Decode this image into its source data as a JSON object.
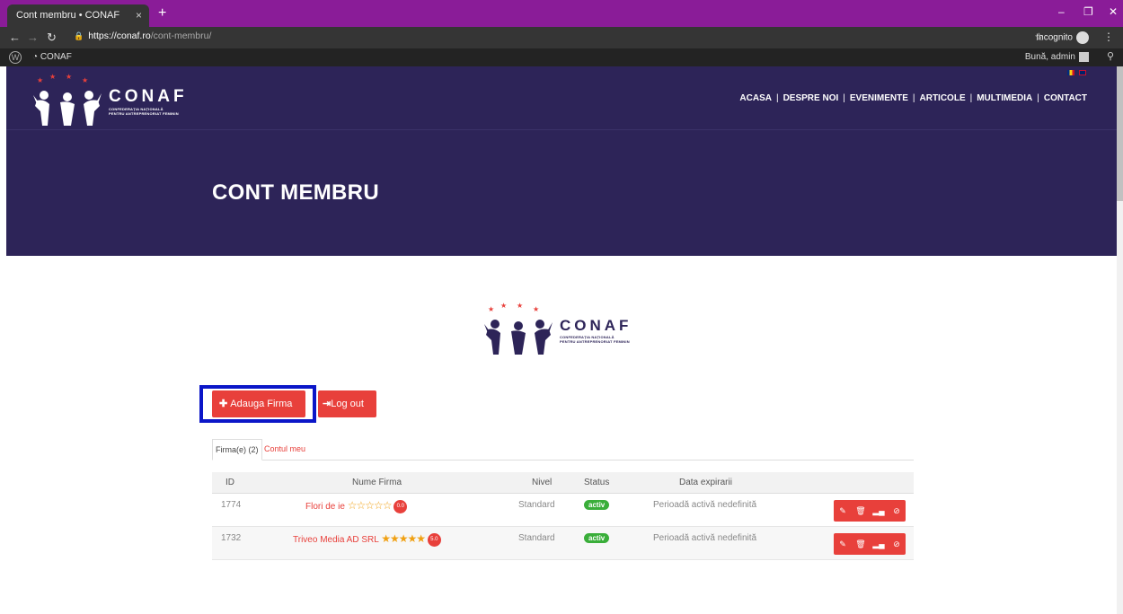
{
  "browser": {
    "tab_title": "Cont membru • CONAF",
    "tab_close": "×",
    "new_tab": "+",
    "url_host": "https://conaf.ro",
    "url_path": "/cont-membru/",
    "incognito_label": "Incognito"
  },
  "wp_admin_bar": {
    "site_name": "CONAF",
    "greeting": "Bună, admin"
  },
  "header": {
    "logo_name": "CONAF",
    "logo_sub_1": "CONFEDERAȚIA NAȚIONALĂ",
    "logo_sub_2": "PENTRU ANTREPRENORIAT FEMININ",
    "nav": [
      "ACASA",
      "DESPRE NOI",
      "EVENIMENTE",
      "ARTICOLE",
      "MULTIMEDIA",
      "CONTACT"
    ],
    "nav_separator": "|"
  },
  "hero": {
    "title": "CONT MEMBRU"
  },
  "actions": {
    "add_company": "Adauga Firma",
    "logout": "Log out"
  },
  "tabs": {
    "companies": "Firma(e) (2)",
    "account": "Contul meu"
  },
  "table": {
    "columns": [
      "ID",
      "Nume Firma",
      "Nivel",
      "Status",
      "Data expirarii"
    ],
    "rows": [
      {
        "id": "1774",
        "name": "Flori de ie",
        "stars": "☆☆☆☆☆",
        "score": "0.0",
        "level": "Standard",
        "status": "activ",
        "expiry": "Perioadă activă nedefinită"
      },
      {
        "id": "1732",
        "name": "Triveo Media AD SRL",
        "stars": "★★★★★",
        "score": "5.0",
        "level": "Standard",
        "status": "activ",
        "expiry": "Perioadă activă nedefinită"
      }
    ]
  },
  "colors": {
    "brand_purple": "#2d2458",
    "accent_red": "#e8403b",
    "status_green": "#3aae3a",
    "highlight_blue": "#0b16c8",
    "tabstrip": "#8a1c98"
  },
  "icons": {
    "back": "back-arrow-icon",
    "forward": "forward-arrow-icon",
    "reload": "reload-icon",
    "lock": "lock-icon",
    "star": "bookmark-star-icon",
    "menu": "kebab-menu-icon",
    "edit": "edit-icon",
    "delete": "trash-icon",
    "stats": "stats-icon",
    "link": "link-icon"
  }
}
